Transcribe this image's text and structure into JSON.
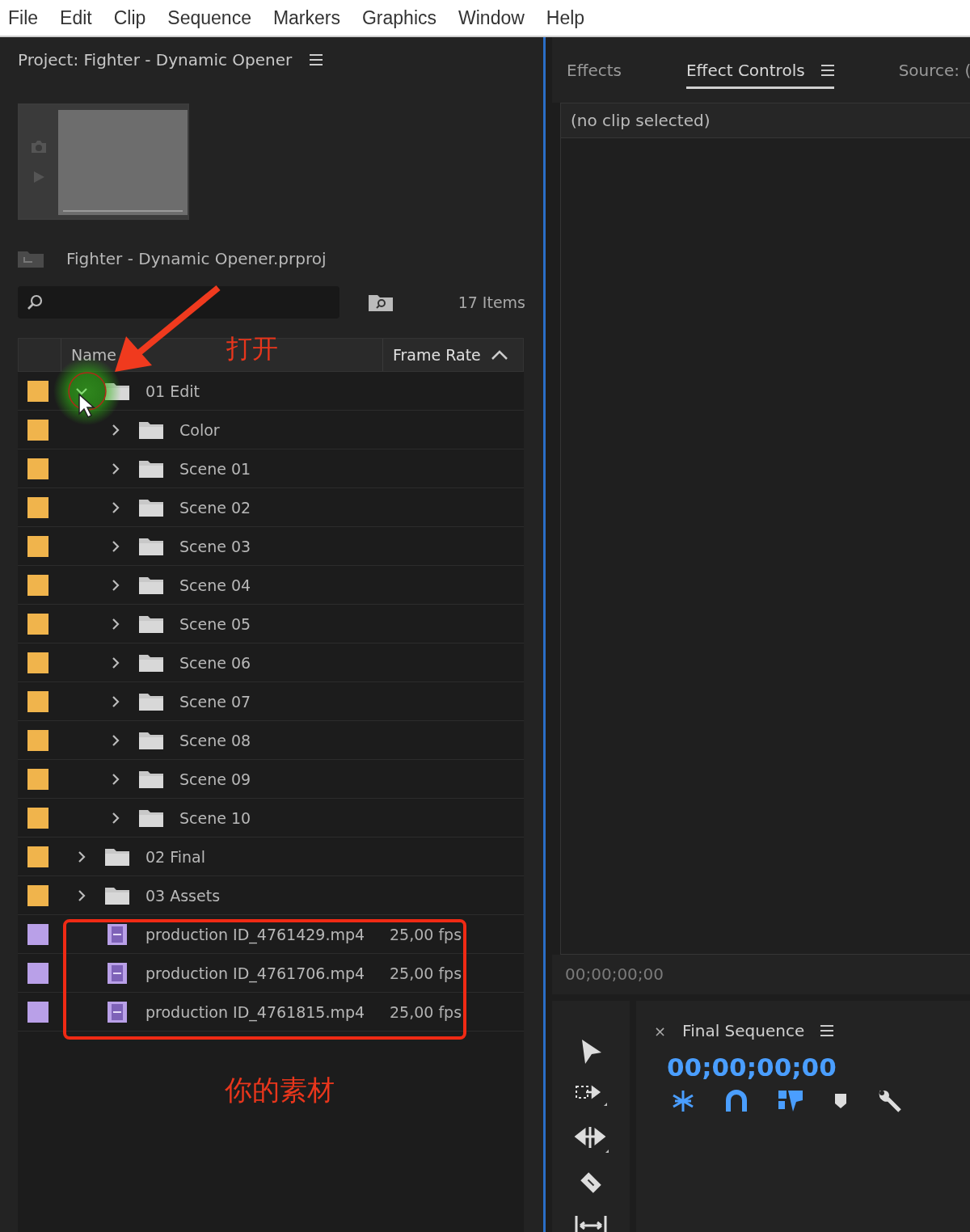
{
  "menu": [
    "File",
    "Edit",
    "Clip",
    "Sequence",
    "Markers",
    "Graphics",
    "Window",
    "Help"
  ],
  "project_panel": {
    "title": "Project: Fighter - Dynamic Opener",
    "file": "Fighter - Dynamic Opener.prproj",
    "item_count": "17 Items",
    "columns": [
      {
        "label": "Name",
        "sorted": false
      },
      {
        "label": "Frame Rate",
        "sorted": true
      }
    ],
    "rows": [
      {
        "kind": "folder",
        "name": "01 Edit",
        "color": "#f0b44c",
        "expanded": true,
        "children": [
          {
            "kind": "folder",
            "name": "Color",
            "color": "#f0b44c",
            "expanded": false
          },
          {
            "kind": "folder",
            "name": "Scene 01",
            "color": "#f0b44c",
            "expanded": false
          },
          {
            "kind": "folder",
            "name": "Scene 02",
            "color": "#f0b44c",
            "expanded": false
          },
          {
            "kind": "folder",
            "name": "Scene 03",
            "color": "#f0b44c",
            "expanded": false
          },
          {
            "kind": "folder",
            "name": "Scene 04",
            "color": "#f0b44c",
            "expanded": false
          },
          {
            "kind": "folder",
            "name": "Scene 05",
            "color": "#f0b44c",
            "expanded": false
          },
          {
            "kind": "folder",
            "name": "Scene 06",
            "color": "#f0b44c",
            "expanded": false
          },
          {
            "kind": "folder",
            "name": "Scene 07",
            "color": "#f0b44c",
            "expanded": false
          },
          {
            "kind": "folder",
            "name": "Scene 08",
            "color": "#f0b44c",
            "expanded": false
          },
          {
            "kind": "folder",
            "name": "Scene 09",
            "color": "#f0b44c",
            "expanded": false
          },
          {
            "kind": "folder",
            "name": "Scene 10",
            "color": "#f0b44c",
            "expanded": false
          }
        ]
      },
      {
        "kind": "folder",
        "name": "02 Final",
        "color": "#f0b44c",
        "expanded": false
      },
      {
        "kind": "folder",
        "name": "03 Assets",
        "color": "#f0b44c",
        "expanded": false
      },
      {
        "kind": "clip",
        "name": "production ID_4761429.mp4",
        "frame_rate": "25,00 fps",
        "color": "#b9a0e8"
      },
      {
        "kind": "clip",
        "name": "production ID_4761706.mp4",
        "frame_rate": "25,00 fps",
        "color": "#b9a0e8"
      },
      {
        "kind": "clip",
        "name": "production ID_4761815.mp4",
        "frame_rate": "25,00 fps",
        "color": "#b9a0e8"
      }
    ]
  },
  "annotations": {
    "open_label": "打开",
    "materials_label": "你的素材"
  },
  "effects_panel": {
    "tabs": [
      {
        "label": "Effects",
        "selected": false
      },
      {
        "label": "Effect Controls",
        "selected": true
      },
      {
        "label": "Source: (",
        "selected": false
      }
    ],
    "empty_message": "(no clip selected)",
    "timecode": "00;00;00;00"
  },
  "timeline": {
    "close": "×",
    "title": "Final Sequence",
    "timecode": "00;00;00;00"
  }
}
